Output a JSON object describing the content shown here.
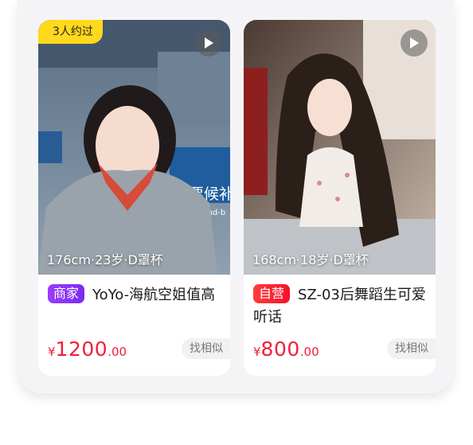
{
  "cards": [
    {
      "booked_tag": "3人约过",
      "stats": "176cm·23岁·D罩杯",
      "badge": "商家",
      "title": "YoYo-海航空姐值高",
      "price_currency": "¥",
      "price_int": "1200",
      "price_dec": ".00",
      "similar_label": "找相似",
      "photo_sign_lines": [
        "客票候补",
        "cket Stand-b"
      ]
    },
    {
      "stats": "168cm·18岁·D罩杯",
      "badge": "自营",
      "title": "SZ-03后舞蹈生可爱听话",
      "price_currency": "¥",
      "price_int": "800",
      "price_dec": ".00",
      "similar_label": "找相似"
    }
  ],
  "colors": {
    "price": "#f0203a",
    "booked_tag_bg": "#ffd91c",
    "merchant_badge": "#8b33ff",
    "self_badge": "#f4122a"
  },
  "icons": {
    "play": "play-icon"
  }
}
